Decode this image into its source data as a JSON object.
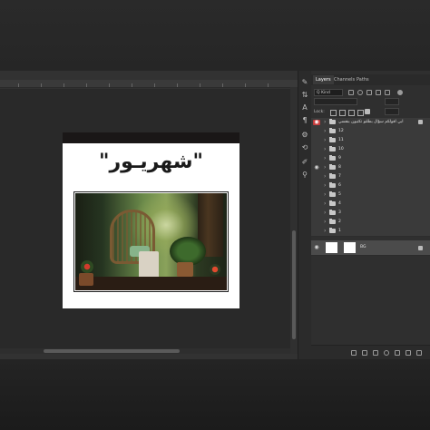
{
  "panel": {
    "tabs": [
      "Layers",
      "Channels",
      "Paths"
    ],
    "filter_kind": "Q Kind",
    "blend_mode": "",
    "opacity": "",
    "fill": "",
    "lock_label": "Lock:",
    "layers": [
      {
        "name": "ابي اقولكم سؤال بطلتو تكتبون بنفسي",
        "visible": true,
        "highlighted": true,
        "type": "group"
      },
      {
        "name": "12",
        "visible": false,
        "type": "group"
      },
      {
        "name": "11",
        "visible": false,
        "type": "group"
      },
      {
        "name": "10",
        "visible": false,
        "type": "group"
      },
      {
        "name": "9",
        "visible": false,
        "type": "group"
      },
      {
        "name": "8",
        "visible": true,
        "type": "group"
      },
      {
        "name": "7",
        "visible": false,
        "type": "group"
      },
      {
        "name": "6",
        "visible": false,
        "type": "group"
      },
      {
        "name": "5",
        "visible": false,
        "type": "group"
      },
      {
        "name": "4",
        "visible": false,
        "type": "group"
      },
      {
        "name": "3",
        "visible": false,
        "type": "group"
      },
      {
        "name": "2",
        "visible": false,
        "type": "group"
      },
      {
        "name": "1",
        "visible": false,
        "type": "group"
      },
      {
        "name": "BG",
        "visible": true,
        "type": "background"
      }
    ]
  },
  "canvas": {
    "headline": "\"شهريـور\""
  },
  "colors": {
    "app_bg": "#323232",
    "panel_bg": "#2f2f2f",
    "highlight_eye": "#c73a3a",
    "canvas_band": "#1a1717"
  }
}
